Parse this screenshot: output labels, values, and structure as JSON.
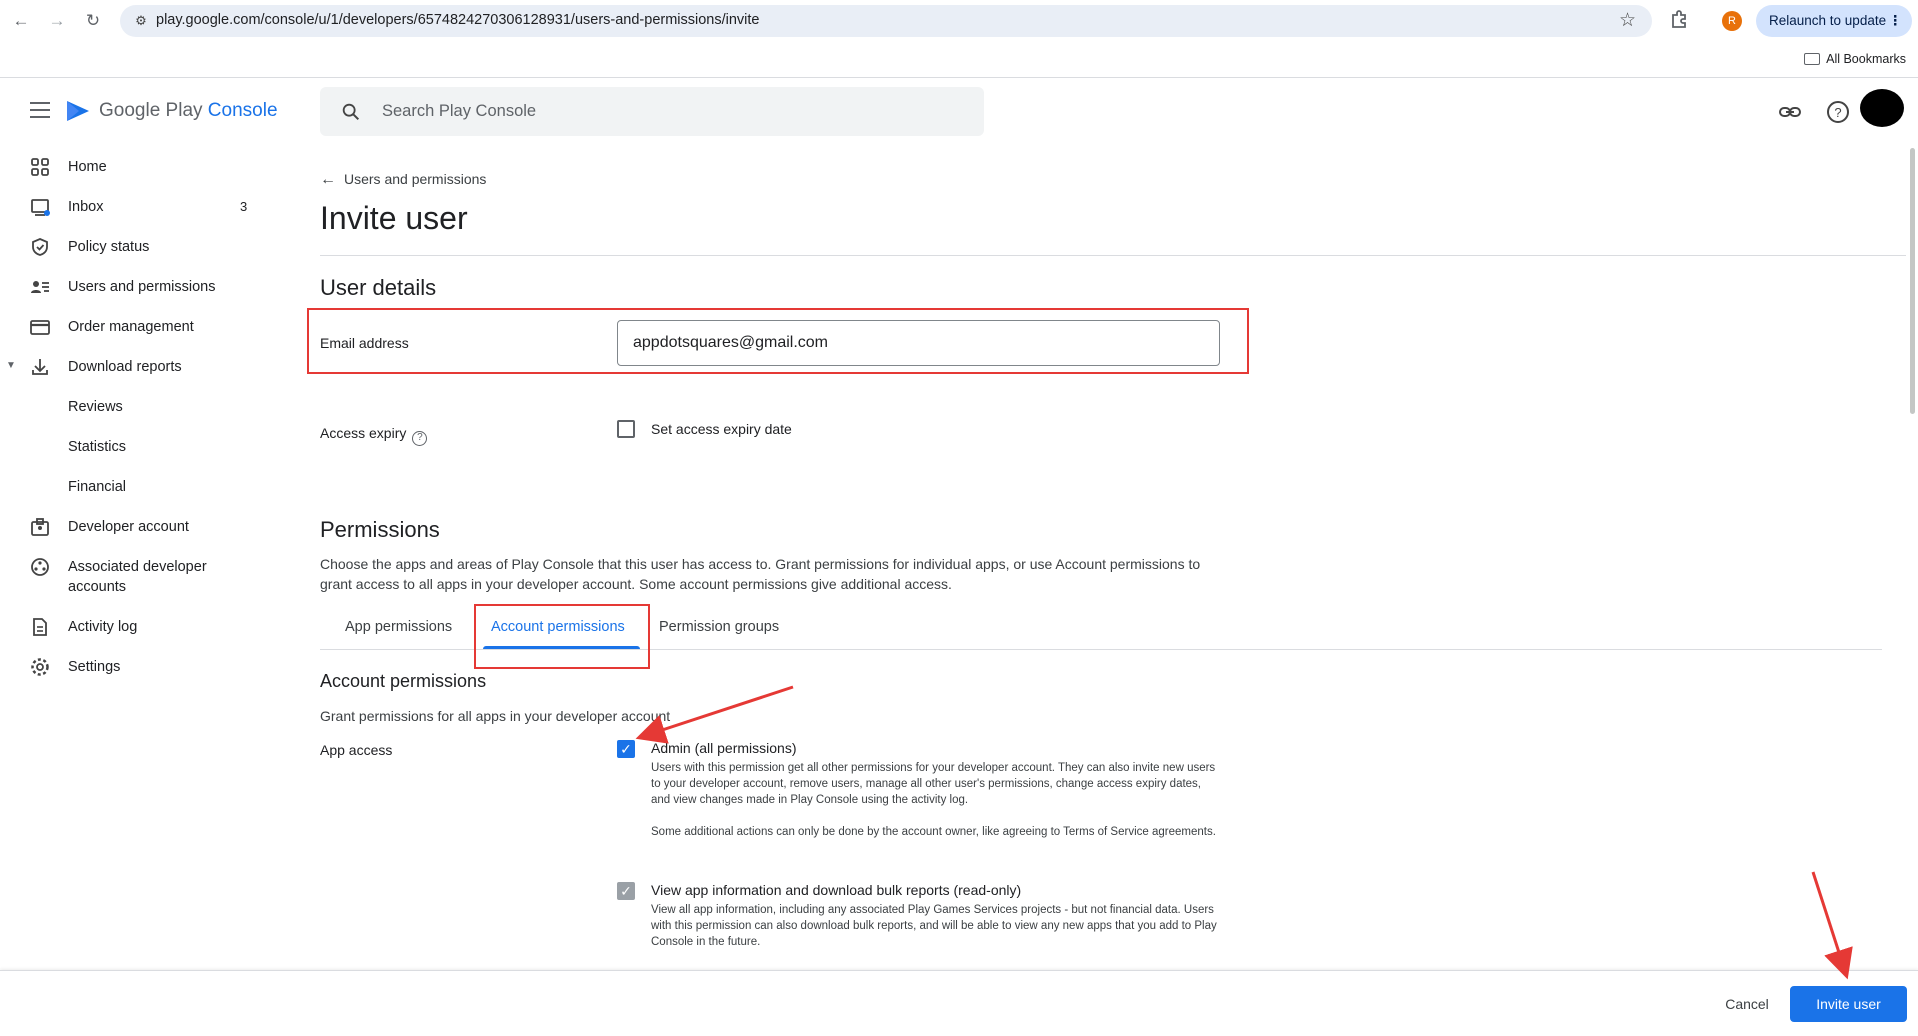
{
  "browser": {
    "url": "play.google.com/console/u/1/developers/6574824270306128931/users-and-permissions/invite",
    "profile_initial": "R",
    "relaunch_label": "Relaunch to update",
    "bookmarks_label": "All Bookmarks"
  },
  "header": {
    "logo_google_play": "Google Play ",
    "logo_console": "Console",
    "search_placeholder": "Search Play Console"
  },
  "sidebar": {
    "items": [
      {
        "label": "Home",
        "icon": "grid-icon"
      },
      {
        "label": "Inbox",
        "icon": "inbox-icon",
        "badge": "3"
      },
      {
        "label": "Policy status",
        "icon": "shield-icon"
      },
      {
        "label": "Users and permissions",
        "icon": "users-icon"
      },
      {
        "label": "Order management",
        "icon": "card-icon"
      },
      {
        "label": "Download reports",
        "icon": "download-icon"
      },
      {
        "label": "Reviews"
      },
      {
        "label": "Statistics"
      },
      {
        "label": "Financial"
      },
      {
        "label": "Developer account",
        "icon": "badge-icon"
      },
      {
        "label": "Associated developer",
        "label2": "accounts",
        "icon": "hub-icon"
      },
      {
        "label": "Activity log",
        "icon": "document-icon"
      },
      {
        "label": "Settings",
        "icon": "gear-icon"
      }
    ]
  },
  "main": {
    "back_link": "Users and permissions",
    "title": "Invite user",
    "user_details_title": "User details",
    "email_label": "Email address",
    "email_value": "appdotsquares@gmail.com",
    "access_expiry_label": "Access expiry",
    "access_expiry_checkbox": "Set access expiry date",
    "permissions_title": "Permissions",
    "permissions_desc": "Choose the apps and areas of Play Console that this user has access to. Grant permissions for individual apps, or use Account permissions to grant access to all apps in your developer account. Some account permissions give additional access.",
    "tabs": [
      "App permissions",
      "Account permissions",
      "Permission groups"
    ],
    "account_permissions_title": "Account permissions",
    "account_permissions_desc": "Grant permissions for all apps in your developer account",
    "app_access_label": "App access",
    "admin_title": "Admin (all permissions)",
    "admin_desc": "Users with this permission get all other permissions for your developer account. They can also invite new users to your developer account, remove users, manage all other user's permissions, change access expiry dates, and view changes made in Play Console using the activity log.",
    "admin_desc2": "Some additional actions can only be done by the account owner, like agreeing to Terms of Service agreements.",
    "view_title": "View app information and download bulk reports (read-only)",
    "view_desc": "View all app information, including any associated Play Games Services projects - but not financial data. Users with this permission can also download bulk reports, and will be able to view any new apps that you add to Play Console in the future."
  },
  "footer": {
    "cancel_label": "Cancel",
    "invite_label": "Invite user"
  },
  "colors": {
    "accent": "#1a73e8",
    "annotation": "#e53935"
  }
}
